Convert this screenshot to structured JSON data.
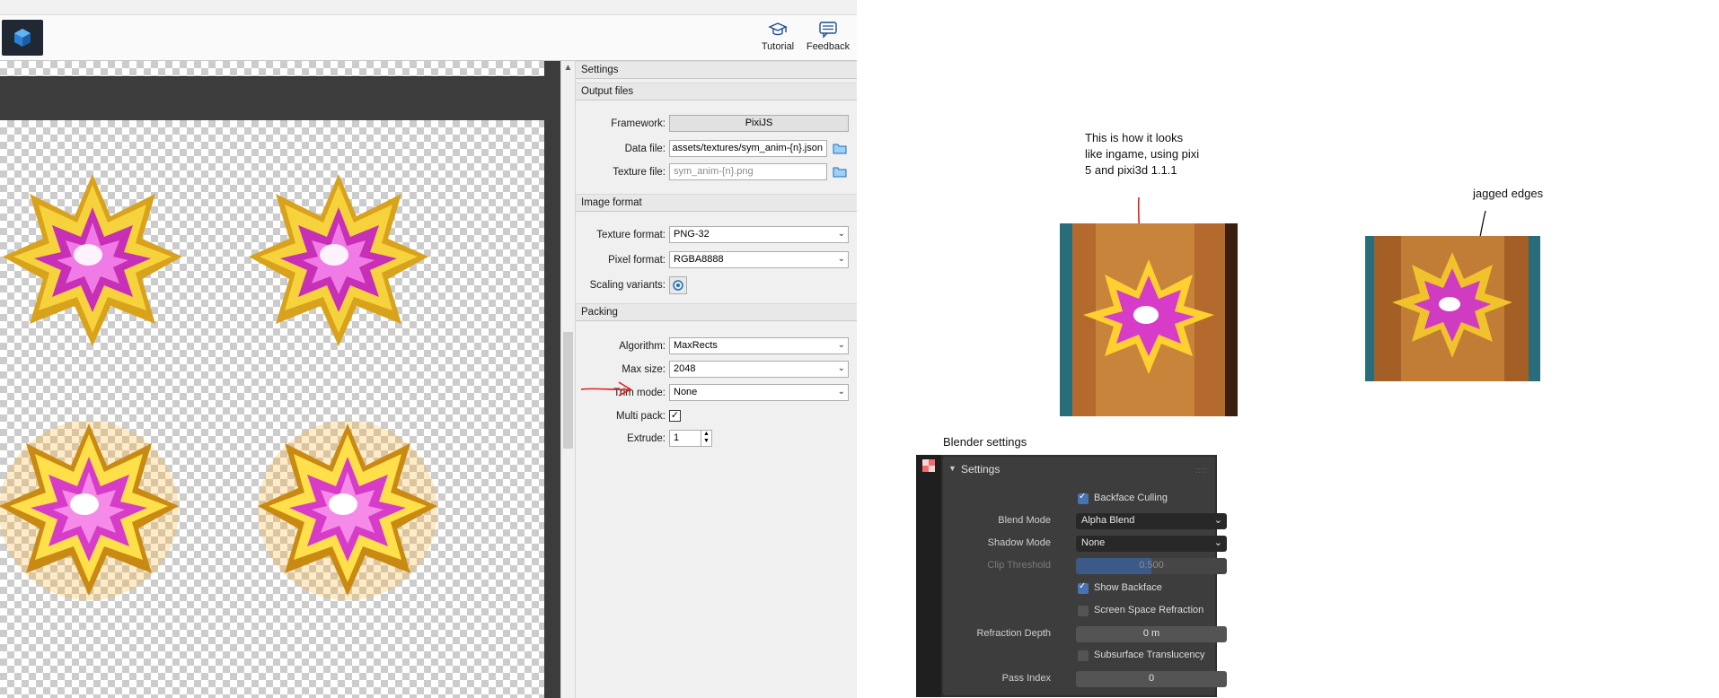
{
  "toolbar": {
    "tutorial_label": "Tutorial",
    "feedback_label": "Feedback"
  },
  "settings": {
    "title": "Settings",
    "output_files": {
      "header": "Output files",
      "framework_label": "Framework:",
      "framework_value": "PixiJS",
      "data_file_label": "Data file:",
      "data_file_value": "assets/textures/sym_anim-{n}.json",
      "texture_file_label": "Texture file:",
      "texture_file_value": "sym_anim-{n}.png"
    },
    "image_format": {
      "header": "Image format",
      "texture_format_label": "Texture format:",
      "texture_format_value": "PNG-32",
      "pixel_format_label": "Pixel format:",
      "pixel_format_value": "RGBA8888",
      "scaling_variants_label": "Scaling variants:"
    },
    "packing": {
      "header": "Packing",
      "algorithm_label": "Algorithm:",
      "algorithm_value": "MaxRects",
      "max_size_label": "Max size:",
      "max_size_value": "2048",
      "trim_mode_label": "Trim mode:",
      "trim_mode_value": "None",
      "multi_pack_label": "Multi pack:",
      "multi_pack_checked": true,
      "extrude_label": "Extrude:",
      "extrude_value": "1"
    }
  },
  "annotations": {
    "ingame_note": "This is how it looks\nlike ingame, using pixi\n5 and pixi3d 1.1.1",
    "jagged_note": "jagged edges",
    "blender_note": "Blender settings"
  },
  "blender": {
    "panel_title": "Settings",
    "backface_culling_label": "Backface Culling",
    "backface_culling_checked": true,
    "blend_mode_label": "Blend Mode",
    "blend_mode_value": "Alpha Blend",
    "shadow_mode_label": "Shadow Mode",
    "shadow_mode_value": "None",
    "clip_threshold_label": "Clip Threshold",
    "clip_threshold_value": "0.500",
    "clip_threshold_fraction": 0.5,
    "show_backface_label": "Show Backface",
    "show_backface_checked": true,
    "screen_space_refraction_label": "Screen Space Refraction",
    "screen_space_refraction_checked": false,
    "refraction_depth_label": "Refraction Depth",
    "refraction_depth_value": "0 m",
    "subsurface_translucency_label": "Subsurface Translucency",
    "subsurface_translucency_checked": false,
    "pass_index_label": "Pass Index",
    "pass_index_value": "0"
  },
  "colors": {
    "accent_red_arrow": "#e02020",
    "blender_check_blue": "#4772b3",
    "star_gold": "#f2c230",
    "star_magenta": "#d63cc8"
  }
}
